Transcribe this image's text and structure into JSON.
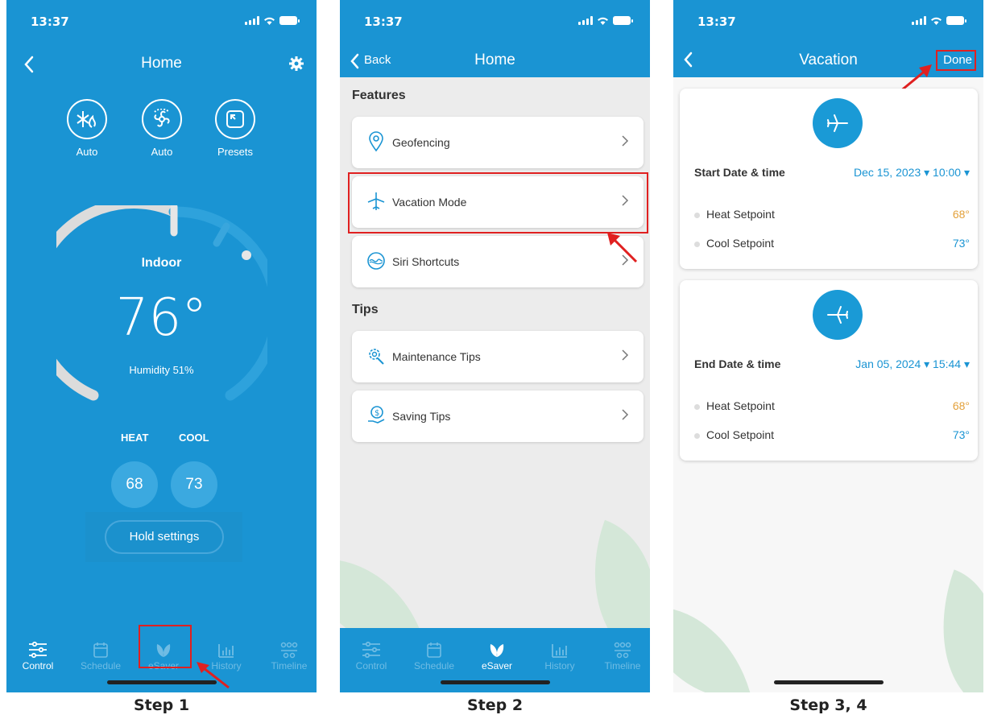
{
  "status": {
    "time": "13:37"
  },
  "step1": {
    "title": "Home",
    "modes": [
      {
        "label": "Auto",
        "icon": "snowflake-flame-icon"
      },
      {
        "label": "Auto",
        "icon": "fan-icon"
      },
      {
        "label": "Presets",
        "icon": "presets-icon"
      }
    ],
    "indoor_label": "Indoor",
    "temperature": "76°",
    "humidity": "Humidity 51%",
    "heat_label": "HEAT",
    "cool_label": "COOL",
    "heat_value": "68",
    "cool_value": "73",
    "hold_label": "Hold settings",
    "caption": "Step 1"
  },
  "tabs": [
    {
      "label": "Control",
      "icon": "sliders-icon"
    },
    {
      "label": "Schedule",
      "icon": "calendar-icon"
    },
    {
      "label": "eSaver",
      "icon": "leaf-icon"
    },
    {
      "label": "History",
      "icon": "bar-chart-icon"
    },
    {
      "label": "Timeline",
      "icon": "timeline-icon"
    }
  ],
  "step2": {
    "back_label": "Back",
    "title": "Home",
    "features_label": "Features",
    "tips_label": "Tips",
    "features": [
      {
        "label": "Geofencing",
        "icon": "location-pin-icon"
      },
      {
        "label": "Vacation Mode",
        "icon": "airplane-icon"
      },
      {
        "label": "Siri Shortcuts",
        "icon": "siri-icon"
      }
    ],
    "tips": [
      {
        "label": "Maintenance Tips",
        "icon": "gear-wrench-icon"
      },
      {
        "label": "Saving Tips",
        "icon": "money-hand-icon"
      }
    ],
    "caption": "Step 2"
  },
  "step3": {
    "title": "Vacation",
    "done_label": "Done",
    "start": {
      "label": "Start Date & time",
      "date": "Dec 15, 2023 ▾ 10:00 ▾",
      "heat_label": "Heat Setpoint",
      "heat_value": "68°",
      "cool_label": "Cool Setpoint",
      "cool_value": "73°"
    },
    "end": {
      "label": "End Date & time",
      "date": "Jan 05, 2024 ▾ 15:44 ▾",
      "heat_label": "Heat Setpoint",
      "heat_value": "68°",
      "cool_label": "Cool Setpoint",
      "cool_value": "73°"
    },
    "caption": "Step 3, 4"
  },
  "colors": {
    "brand_blue": "#1a94d3",
    "highlight_red": "#e02020",
    "heat_orange": "#e3a13b"
  }
}
